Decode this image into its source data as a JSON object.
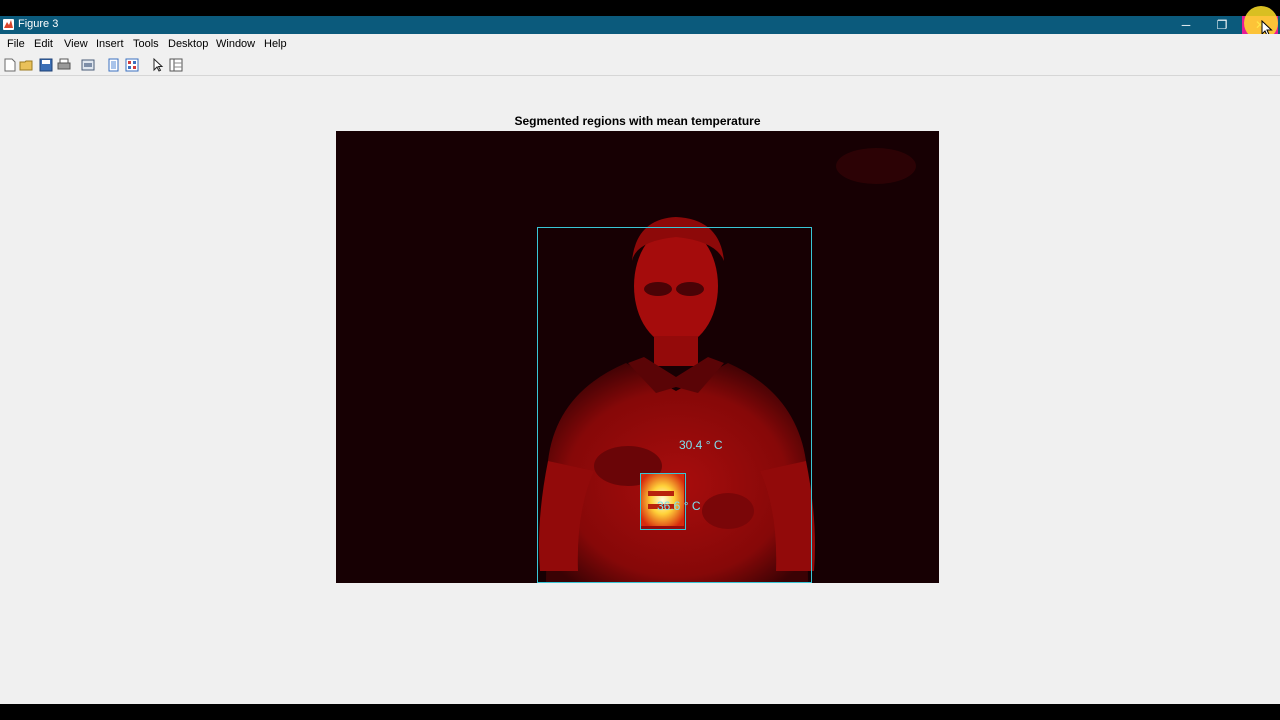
{
  "window": {
    "title": "Figure 3",
    "minimize_glyph": "─",
    "restore_glyph": "❐",
    "close_glyph": "✕"
  },
  "menu": {
    "items": [
      "File",
      "Edit",
      "View",
      "Insert",
      "Tools",
      "Desktop",
      "Window",
      "Help"
    ]
  },
  "toolbar": {
    "icons": [
      "new-figure-icon",
      "open-file-icon",
      "save-icon",
      "print-icon",
      "print-preview-icon",
      "show-plot-tools-icon",
      "hide-plot-tools-icon",
      "edit-plot-cursor-icon",
      "property-editor-icon"
    ]
  },
  "figure": {
    "title": "Segmented regions with mean temperature",
    "regions": [
      {
        "label": "30.4 ° C"
      },
      {
        "label": "36.6 ° C"
      }
    ]
  },
  "colors": {
    "titlebar": "#0b5a7c",
    "close_button": "#e81b96",
    "region_box": "#39c6d6",
    "region_label": "#7fe0ee",
    "background": "#f0f0f0"
  }
}
